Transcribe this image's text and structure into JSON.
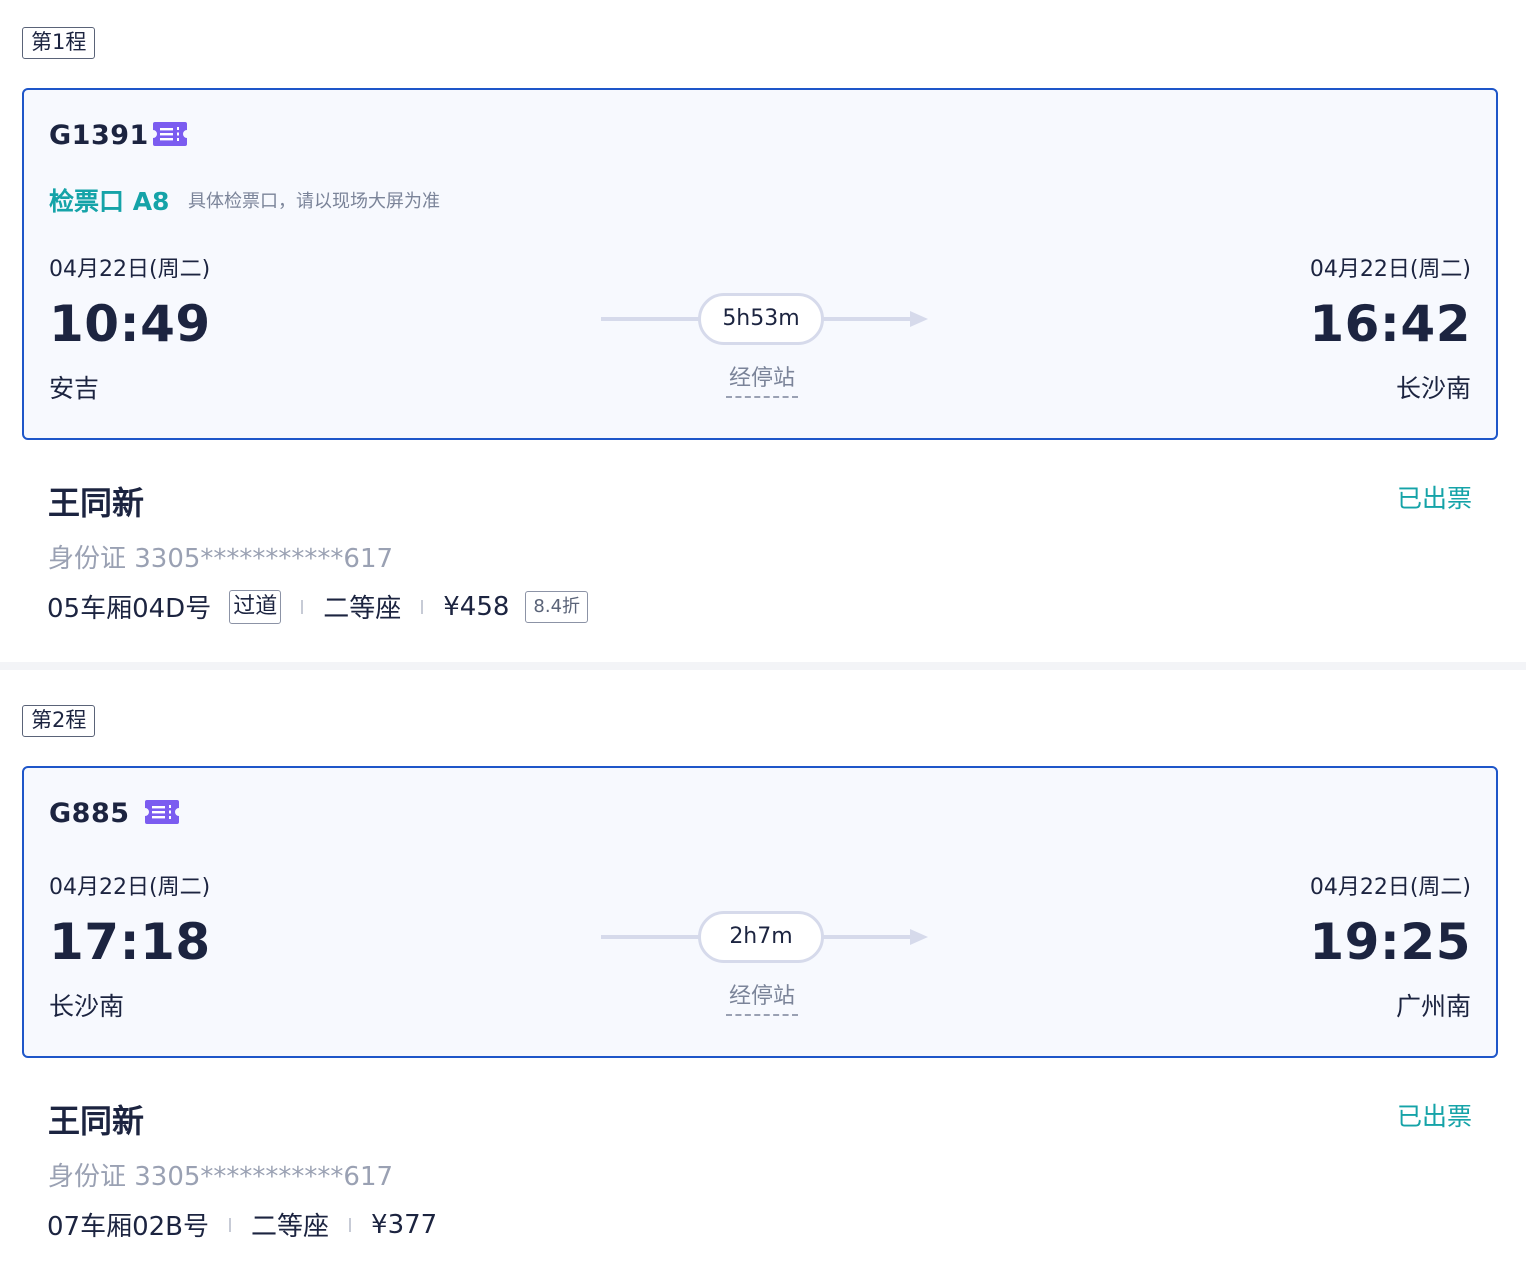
{
  "legs": [
    {
      "tag": "第1程",
      "train_no": "G1391",
      "ticket_icon": "ticket-icon",
      "gate": {
        "label": "检票口 A8",
        "note": "具体检票口，请以现场大屏为准"
      },
      "depart": {
        "date": "04月22日(周二)",
        "time": "10:49",
        "station": "安吉"
      },
      "arrive": {
        "date": "04月22日(周二)",
        "time": "16:42",
        "station": "长沙南"
      },
      "duration": "5h53m",
      "stops_link": "经停站",
      "passenger": {
        "name": "王同新",
        "status": "已出票",
        "id": "身份证 3305***********617",
        "seat": "05车厢04D号",
        "seat_tag": "过道",
        "class": "二等座",
        "price": "¥458",
        "discount": "8.4折"
      }
    },
    {
      "tag": "第2程",
      "train_no": "G885",
      "ticket_icon": "ticket-icon",
      "depart": {
        "date": "04月22日(周二)",
        "time": "17:18",
        "station": "长沙南"
      },
      "arrive": {
        "date": "04月22日(周二)",
        "time": "19:25",
        "station": "广州南"
      },
      "duration": "2h7m",
      "stops_link": "经停站",
      "passenger": {
        "name": "王同新",
        "status": "已出票",
        "id": "身份证 3305***********617",
        "seat": "07车厢02B号",
        "class": "二等座",
        "price": "¥377"
      }
    }
  ],
  "colors": {
    "card_border": "#1e56c9",
    "card_bg": "#f7f9fe",
    "teal": "#15a3a8",
    "icon_purple": "#7b5cf0",
    "text_dark": "#1c2440",
    "text_muted": "#9aa1b3"
  }
}
